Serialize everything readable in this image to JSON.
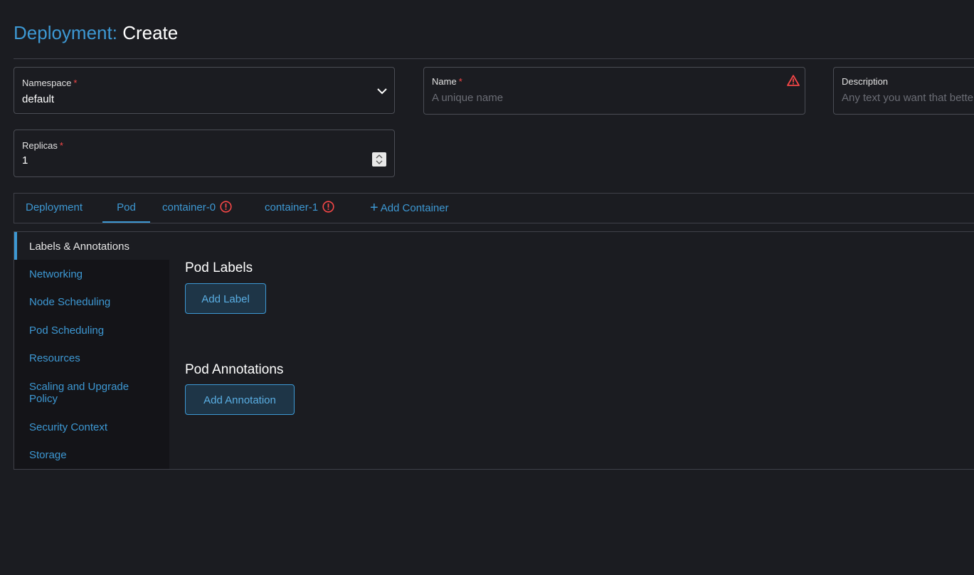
{
  "header": {
    "crumb": "Deployment:",
    "action": "Create"
  },
  "form": {
    "namespace": {
      "label": "Namespace",
      "required": "*",
      "value": "default"
    },
    "name": {
      "label": "Name",
      "required": "*",
      "placeholder": "A unique name"
    },
    "description": {
      "label": "Description",
      "placeholder": "Any text you want that better describes this resource"
    },
    "replicas": {
      "label": "Replicas",
      "required": "*",
      "value": "1"
    }
  },
  "tabs": [
    {
      "label": "Deployment",
      "active": false
    },
    {
      "label": "Pod",
      "active": true
    },
    {
      "label": "container-0",
      "error": true
    },
    {
      "label": "container-1",
      "error": true
    },
    {
      "label": "Add Container",
      "icon": "plus-icon"
    }
  ],
  "sidebar": {
    "items": [
      {
        "label": "Labels & Annotations",
        "active": true
      },
      {
        "label": "Networking"
      },
      {
        "label": "Node Scheduling"
      },
      {
        "label": "Pod Scheduling"
      },
      {
        "label": "Resources"
      },
      {
        "label": "Scaling and Upgrade Policy"
      },
      {
        "label": "Security Context"
      },
      {
        "label": "Storage"
      }
    ]
  },
  "main": {
    "labels_title": "Pod Labels",
    "add_label": "Add Label",
    "annotations_title": "Pod Annotations",
    "add_annotation": "Add Annotation"
  },
  "colors": {
    "accent": "#3d98d3",
    "error": "#f64747",
    "background": "#1b1c21"
  }
}
